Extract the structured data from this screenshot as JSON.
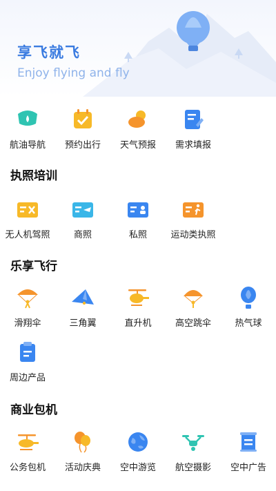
{
  "header": {
    "title": "享飞就飞",
    "subtitle": "Enjoy flying and fly"
  },
  "services": {
    "items": [
      {
        "label": "航油导航",
        "icon": "fuel-navigation-icon"
      },
      {
        "label": "预约出行",
        "icon": "calendar-check-icon"
      },
      {
        "label": "天气预报",
        "icon": "weather-sun-cloud-icon"
      },
      {
        "label": "需求填报",
        "icon": "form-edit-icon"
      }
    ]
  },
  "sections": [
    {
      "title": "执照培训",
      "items": [
        {
          "label": "无人机驾照",
          "icon": "drone-license-icon"
        },
        {
          "label": "商照",
          "icon": "commercial-license-icon"
        },
        {
          "label": "私照",
          "icon": "private-license-icon"
        },
        {
          "label": "运动类执照",
          "icon": "sport-license-icon"
        }
      ]
    },
    {
      "title": "乐享飞行",
      "items": [
        {
          "label": "滑翔伞",
          "icon": "paraglider-icon"
        },
        {
          "label": "三角翼",
          "icon": "hang-glider-icon"
        },
        {
          "label": "直升机",
          "icon": "helicopter-icon"
        },
        {
          "label": "高空跳伞",
          "icon": "skydiving-icon"
        },
        {
          "label": "热气球",
          "icon": "hot-air-balloon-icon"
        },
        {
          "label": "周边产品",
          "icon": "merchandise-icon"
        }
      ]
    },
    {
      "title": "商业包机",
      "items": [
        {
          "label": "公务包机",
          "icon": "business-charter-icon"
        },
        {
          "label": "活动庆典",
          "icon": "celebration-balloons-icon"
        },
        {
          "label": "空中游览",
          "icon": "aerial-tour-icon"
        },
        {
          "label": "航空摄影",
          "icon": "aerial-photography-drone-icon"
        },
        {
          "label": "空中广告",
          "icon": "aerial-advertising-icon"
        }
      ]
    }
  ],
  "colors": {
    "accent": "#3a7be0",
    "orange": "#f5942c",
    "teal": "#2fc4b2",
    "blue": "#3a86f0",
    "yellow": "#f7b928"
  }
}
